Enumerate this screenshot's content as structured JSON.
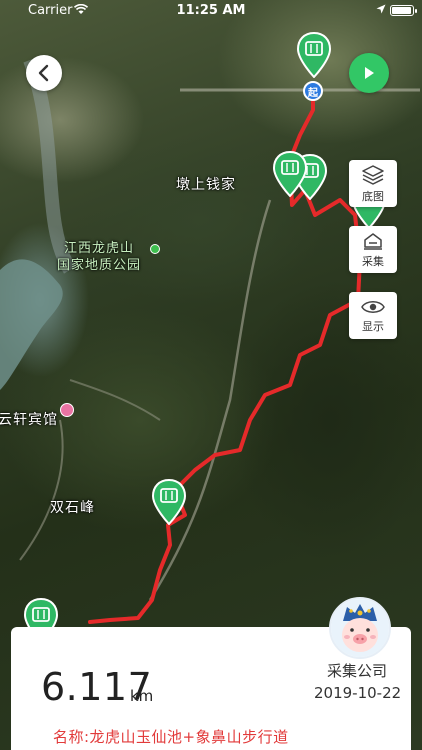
{
  "status_bar": {
    "carrier": "Carrier",
    "time": "11:25 AM"
  },
  "map": {
    "labels": {
      "village_1": "墩上钱家",
      "park": "江西龙虎山\n国家地质公园",
      "hotel": "云轩宾馆",
      "peak": "双石峰"
    },
    "start_marker": "起",
    "route_color": "#e52a2a",
    "marker_color": "#2fb864"
  },
  "toolbar": {
    "basemap_label": "底图",
    "collect_label": "采集",
    "display_label": "显示"
  },
  "info_card": {
    "distance_value": "6.117",
    "distance_unit": "km",
    "company_name": "采集公司",
    "record_date": "2019-10-22",
    "route_name": "名称:龙虎山玉仙池+象鼻山步行道"
  },
  "colors": {
    "accent_green": "#32c766",
    "route_red": "#e52a2a",
    "start_blue": "#2d7be0"
  }
}
